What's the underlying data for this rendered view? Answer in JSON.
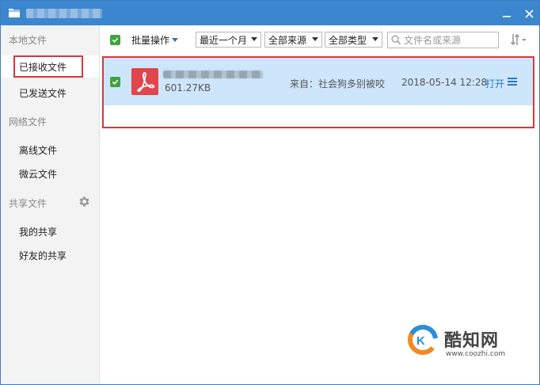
{
  "window": {
    "title_icon": "folder-icon",
    "buttons": {
      "minimize_icon": "minimize-icon",
      "close_icon": "close-icon"
    }
  },
  "sidebar": {
    "sections": [
      {
        "label": "本地文件",
        "items": [
          "已接收文件",
          "已发送文件"
        ]
      },
      {
        "label": "网络文件",
        "items": [
          "离线文件",
          "微云文件"
        ]
      },
      {
        "label": "共享文件",
        "items": [
          "我的共享",
          "好友的共享"
        ]
      }
    ],
    "active_item": "已接收文件",
    "settings_icon": "gear-icon"
  },
  "toolbar": {
    "batch_label": "批量操作",
    "time_filter": "最近一个月",
    "source_filter": "全部来源",
    "type_filter": "全部类型",
    "search_placeholder": "文件名或来源",
    "sort_icon": "sort-icon"
  },
  "files": [
    {
      "icon": "pdf-icon",
      "size": "601.27KB",
      "source": "来自：社会狗多别被咬",
      "date": "2018-05-14 12:28",
      "action": "打开",
      "checked": true
    }
  ],
  "colors": {
    "titlebar": "#3b86cf",
    "sidebar_bg": "#f3f3f3",
    "selected_row": "#cde6fb",
    "highlight_border": "#d6383d",
    "check_green": "#3fa53f",
    "link_blue": "#2f74c7",
    "pdf_red": "#e0474c"
  },
  "watermark": {
    "name": "酷知网",
    "url": "www.coozhi.com"
  }
}
